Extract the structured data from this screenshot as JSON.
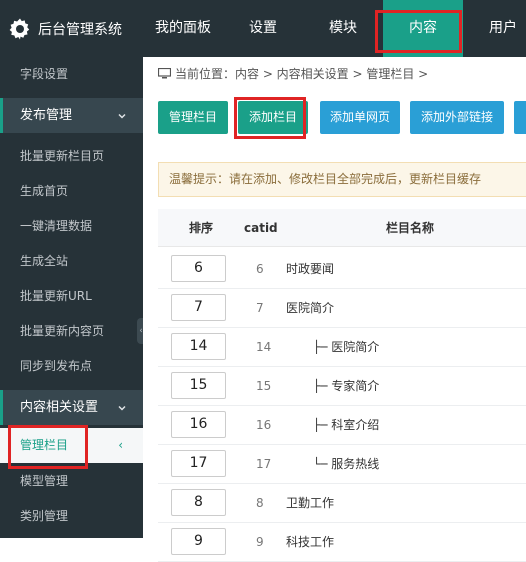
{
  "app": {
    "title": "后台管理系统",
    "logo_icon": "gear-icon"
  },
  "top_nav": [
    {
      "label": "我的面板"
    },
    {
      "label": "设置"
    },
    {
      "label": "模块"
    },
    {
      "label": "内容",
      "active": true
    },
    {
      "label": "用户"
    }
  ],
  "sidebar": {
    "items": [
      {
        "label": "字段设置"
      },
      {
        "label": "发布管理",
        "group": true
      },
      {
        "label": "批量更新栏目页"
      },
      {
        "label": "生成首页"
      },
      {
        "label": "一键清理数据"
      },
      {
        "label": "生成全站"
      },
      {
        "label": "批量更新URL"
      },
      {
        "label": "批量更新内容页"
      },
      {
        "label": "同步到发布点"
      },
      {
        "label": "内容相关设置",
        "group": true
      },
      {
        "label": "管理栏目",
        "active": true,
        "arrow": "‹"
      },
      {
        "label": "模型管理"
      },
      {
        "label": "类别管理"
      }
    ],
    "chevron": "⌄",
    "collapse_glyph": "‹"
  },
  "breadcrumb": {
    "icon": "monitor-icon",
    "text": "当前位置：内容 > 内容相关设置 > 管理栏目 >"
  },
  "toolbar": {
    "buttons": [
      {
        "label": "管理栏目"
      },
      {
        "label": "添加栏目"
      },
      {
        "label": "添加单网页"
      },
      {
        "label": "添加外部链接"
      },
      {
        "label": ""
      }
    ]
  },
  "alert": {
    "text": "温馨提示：请在添加、修改栏目全部完成后，更新栏目缓存"
  },
  "table": {
    "headers": {
      "order": "排序",
      "catid": "catid",
      "name": "栏目名称"
    },
    "rows": [
      {
        "order": "6",
        "catid": "6",
        "name": "时政要闻"
      },
      {
        "order": "7",
        "catid": "7",
        "name": "医院简介"
      },
      {
        "order": "14",
        "catid": "14",
        "name": "├─ 医院简介"
      },
      {
        "order": "15",
        "catid": "15",
        "name": "├─ 专家简介"
      },
      {
        "order": "16",
        "catid": "16",
        "name": "├─ 科室介绍"
      },
      {
        "order": "17",
        "catid": "17",
        "name": "└─ 服务热线"
      },
      {
        "order": "8",
        "catid": "8",
        "name": "卫勤工作"
      },
      {
        "order": "9",
        "catid": "9",
        "name": "科技工作"
      }
    ]
  },
  "colors": {
    "sidebar_bg": "#263238",
    "accent_green": "#1aa089",
    "button_blue": "#2a9fd6",
    "highlight_red": "#e02424"
  }
}
